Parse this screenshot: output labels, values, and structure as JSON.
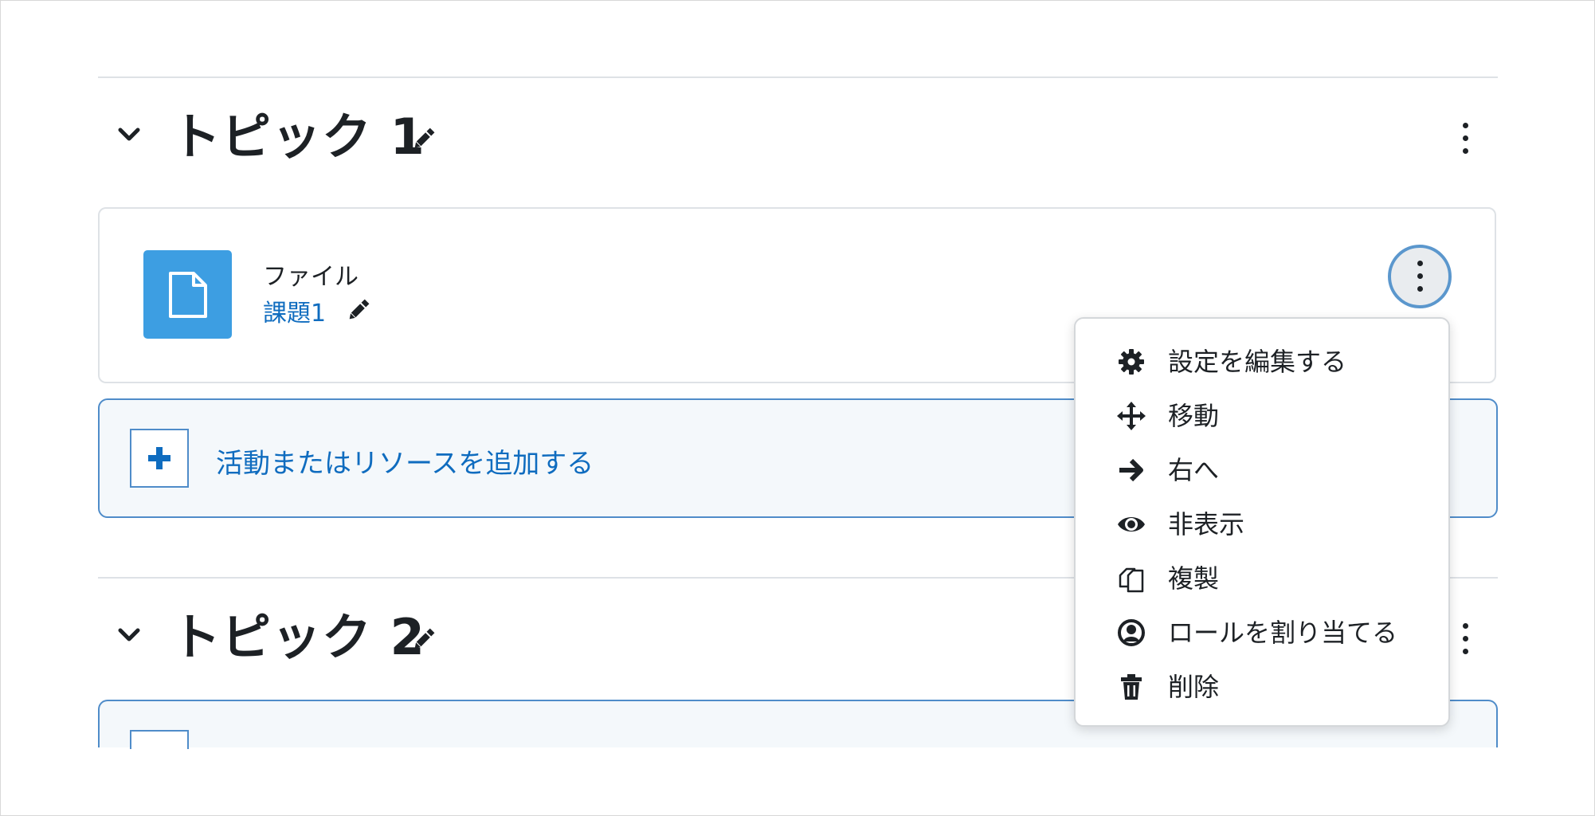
{
  "sections": [
    {
      "title": "トピック 1",
      "activity": {
        "type": "ファイル",
        "name": "課題1"
      },
      "add_label": "活動またはリソースを追加する"
    },
    {
      "title": "トピック 2"
    }
  ],
  "action_menu": {
    "items": [
      {
        "label": "設定を編集する",
        "icon": "gear-icon"
      },
      {
        "label": "移動",
        "icon": "move-arrows-icon"
      },
      {
        "label": "右へ",
        "icon": "arrow-right-icon"
      },
      {
        "label": "非表示",
        "icon": "eye-icon"
      },
      {
        "label": "複製",
        "icon": "duplicate-icon"
      },
      {
        "label": "ロールを割り当てる",
        "icon": "user-circle-icon"
      },
      {
        "label": "削除",
        "icon": "trash-icon"
      }
    ]
  },
  "colors": {
    "link": "#0f6cbf",
    "file_icon_bg": "#3d9ee2",
    "add_border": "#4f8cc9",
    "add_bg": "#f4f8fb"
  }
}
